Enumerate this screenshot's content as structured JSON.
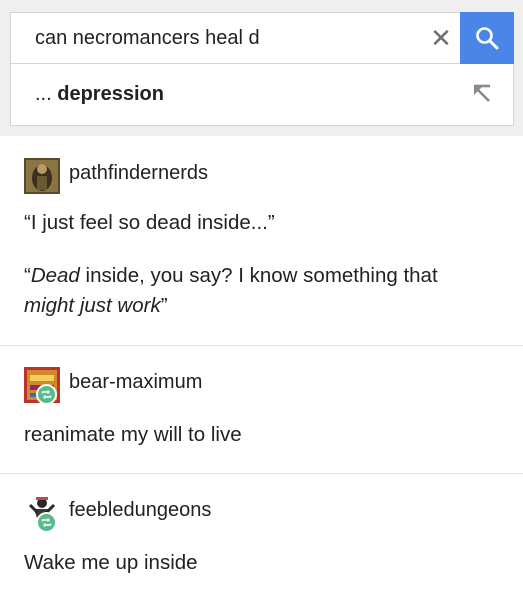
{
  "search": {
    "query": "can necromancers heal d",
    "suggestion_prefix": "... ",
    "suggestion_bold": "depression"
  },
  "icons": {
    "clear": "close-icon",
    "search": "search-icon",
    "suggestion": "arrow-up-left-icon",
    "reblog": "reblog-icon"
  },
  "colors": {
    "search_button": "#4a86e8",
    "reblog_badge": "#56bc8a",
    "text": "#222222"
  },
  "posts": [
    {
      "username": "pathfindernerds",
      "lines": [
        "“I just feel so dead inside...”"
      ],
      "reply": {
        "part1": "“",
        "part2": "Dead",
        "part3": " inside, you say? I know something that",
        "part4": "might just work",
        "part5": "”"
      }
    },
    {
      "username": "bear-maximum",
      "text": "reanimate my will to live"
    },
    {
      "username": "feebledungeons",
      "text": "Wake me up inside"
    }
  ]
}
